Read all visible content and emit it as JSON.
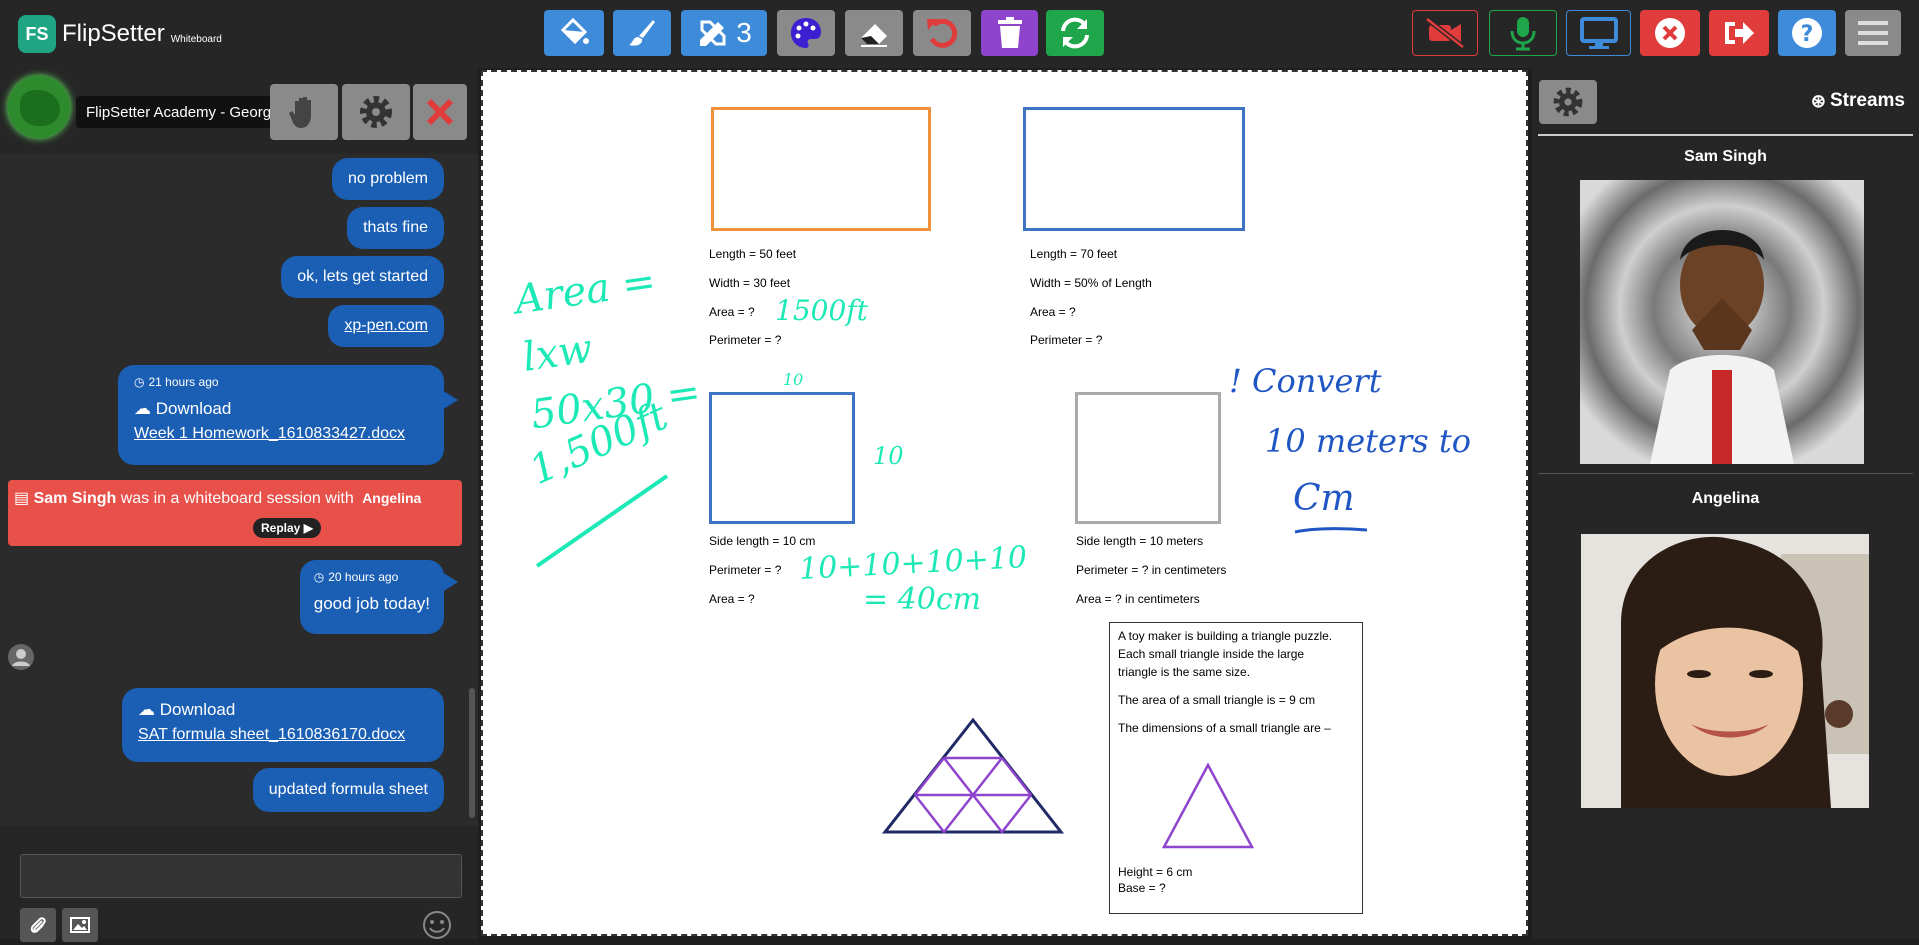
{
  "app": {
    "logo_badge": "FS",
    "name": "FlipSetter",
    "subtitle": "Whiteboard"
  },
  "toolbar": {
    "tool_count": "3",
    "colors": {
      "tool_blue": "#3d8bd9",
      "palette_purple": "#8a2be2",
      "undo_red": "#e03c3c",
      "trash_purple": "#8e44cc",
      "sync_green": "#1fa54a"
    },
    "icons": [
      "fill-icon",
      "brush-icon",
      "pencil-ruler-icon",
      "palette-icon",
      "eraser-icon",
      "undo-icon",
      "trash-icon",
      "sync-icon",
      "video-off-icon",
      "microphone-icon",
      "screen-share-icon",
      "close-circle-icon",
      "sign-out-icon",
      "help-icon",
      "menu-icon"
    ]
  },
  "chat": {
    "course_name": "FlipSetter Academy - Georgia",
    "messages": [
      {
        "text": "no problem"
      },
      {
        "text": "thats fine"
      },
      {
        "text": "ok, lets get started"
      },
      {
        "link": "xp-pen.com"
      }
    ],
    "file1": {
      "timestamp": "21 hours ago",
      "download_label": "Download",
      "filename": "Week 1 Homework_1610833427.docx"
    },
    "notice": {
      "user": "Sam Singh",
      "text": "was in a whiteboard session with",
      "other": "Angelina",
      "replay": "Replay"
    },
    "msg_good": {
      "timestamp": "20 hours ago",
      "text": "good job today!"
    },
    "file2": {
      "download_label": "Download",
      "filename": "SAT formula sheet_1610836170.docx"
    },
    "msg_last": "updated formula sheet",
    "input_placeholder": ""
  },
  "whiteboard": {
    "rect1": {
      "length": "Length = 50 feet",
      "width": "Width = 30 feet",
      "area": "Area = ?",
      "perimeter": "Perimeter = ?"
    },
    "rect2": {
      "length": "Length = 70 feet",
      "width": "Width = 50% of Length",
      "area": "Area = ?",
      "perimeter": "Perimeter = ?"
    },
    "sq1": {
      "side": "Side length = 10 cm",
      "perimeter": "Perimeter = ?",
      "area": "Area = ?"
    },
    "sq2": {
      "side": "Side length = 10 meters",
      "perimeter": "Perimeter = ? in centimeters",
      "area": "Area = ? in centimeters"
    },
    "problem": {
      "line1": "A toy maker is building a triangle puzzle.",
      "line2": "Each small triangle inside the large",
      "line3": "triangle is the same size.",
      "line4": "The area of a small triangle is = 9 cm",
      "line5": "The dimensions of a small triangle are –",
      "height": "Height = 6 cm",
      "base": "Base = ?"
    },
    "handwriting": {
      "area_label": "Area =",
      "lxw": "lxw",
      "calc": "50x30 =",
      "result": "1,500ft",
      "answer1": "1500ft",
      "ten_top": "10",
      "ten_side": "10",
      "sum": "10+10+10+10",
      "sum_result": "= 40cm",
      "convert1": "! Convert",
      "convert2": "10 meters to",
      "convert3": "Cm"
    },
    "ink_color": "#1de9b6",
    "note_color": "#1f56c4"
  },
  "streams": {
    "title": "Streams",
    "people": [
      {
        "name": "Sam Singh"
      },
      {
        "name": "Angelina"
      }
    ]
  }
}
